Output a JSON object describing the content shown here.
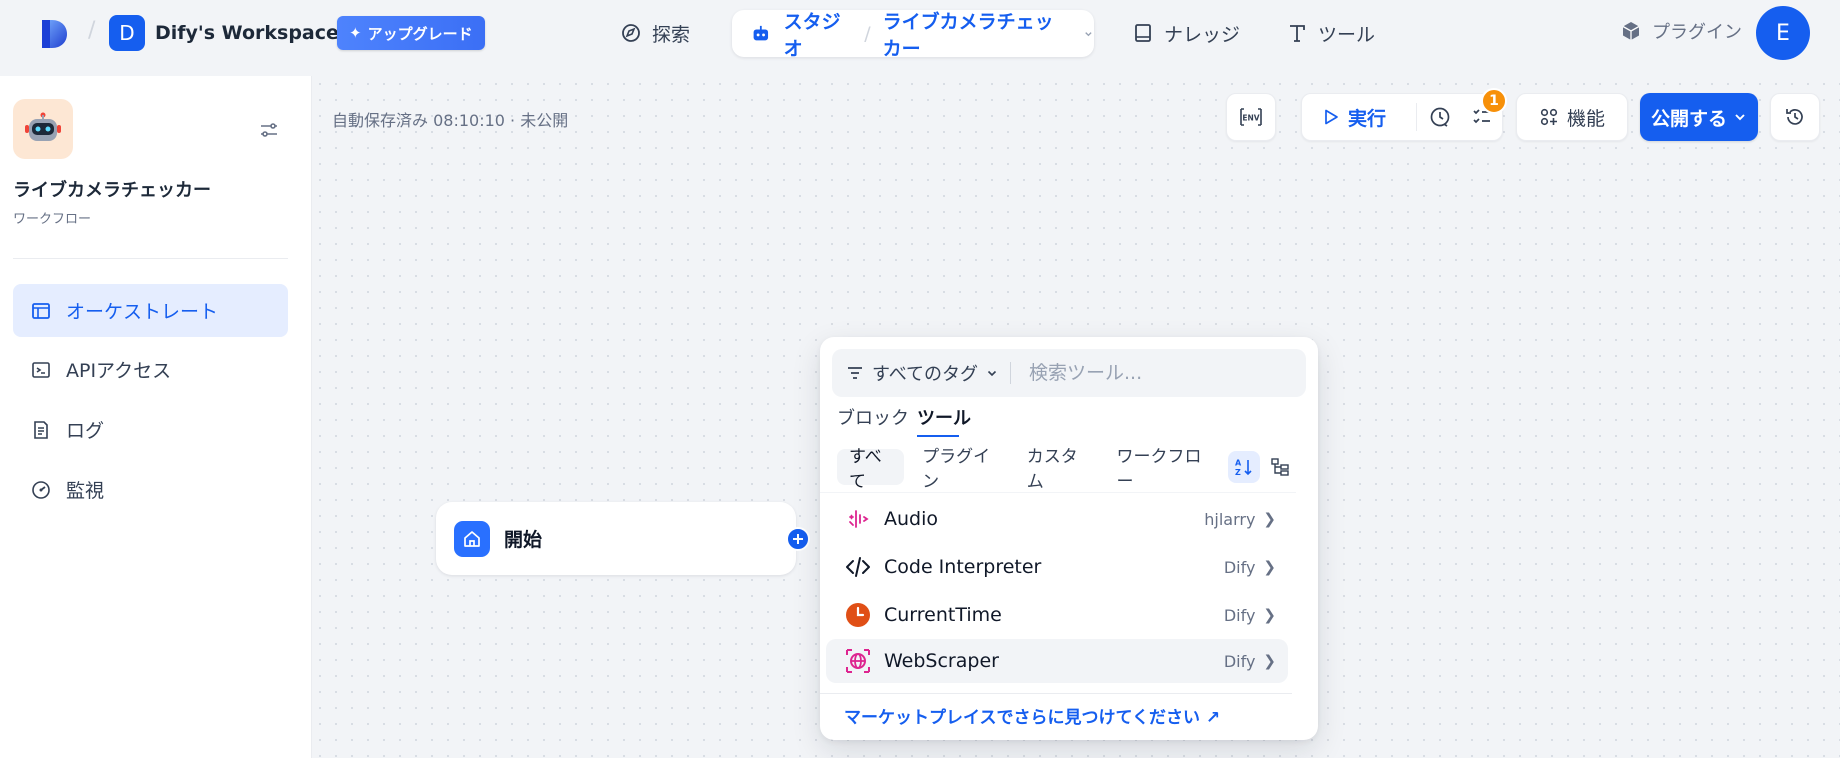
{
  "header": {
    "workspace_initial": "D",
    "workspace_name": "Dify's Workspace",
    "upgrade_label": "アップグレード",
    "nav_explore": "探索",
    "nav_studio": "スタジオ",
    "nav_app": "ライブカメラチェッカー",
    "nav_knowledge": "ナレッジ",
    "nav_tools": "ツール",
    "nav_plugins": "プラグイン",
    "avatar_initial": "E"
  },
  "sidebar": {
    "app_name": "ライブカメラチェッカー",
    "app_type": "ワークフロー",
    "items": [
      {
        "label": "オーケストレート",
        "icon": "layout-icon",
        "active": true
      },
      {
        "label": "APIアクセス",
        "icon": "terminal-icon",
        "active": false
      },
      {
        "label": "ログ",
        "icon": "log-icon",
        "active": false
      },
      {
        "label": "監視",
        "icon": "gauge-icon",
        "active": false
      }
    ]
  },
  "toolbar": {
    "autosave": "自動保存済み 08:10:10 · 未公開",
    "env_label": "ENV",
    "run_label": "実行",
    "checklist_count": "1",
    "features_label": "機能",
    "publish_label": "公開する"
  },
  "canvas": {
    "start_label": "開始"
  },
  "picker": {
    "tag_filter": "すべてのタグ",
    "search_placeholder": "検索ツール...",
    "tabs": [
      "ブロック",
      "ツール"
    ],
    "active_tab": "ツール",
    "filters": [
      "すべて",
      "プラグイン",
      "カスタム",
      "ワークフロー"
    ],
    "active_filter": "すべて",
    "tools": [
      {
        "name": "Audio",
        "author": "hjlarry",
        "icon": "audio-icon",
        "color": "#dd2590"
      },
      {
        "name": "Code Interpreter",
        "author": "Dify",
        "icon": "code-icon",
        "color": "#101828"
      },
      {
        "name": "CurrentTime",
        "author": "Dify",
        "icon": "clock-icon",
        "color": "#e04f16"
      },
      {
        "name": "WebScraper",
        "author": "Dify",
        "icon": "web-scraper-icon",
        "color": "#dd2590"
      }
    ],
    "marketplace_link": "マーケットプレイスでさらに見つけてください ↗"
  },
  "colors": {
    "accent": "#155eef",
    "badge": "#f79009"
  }
}
